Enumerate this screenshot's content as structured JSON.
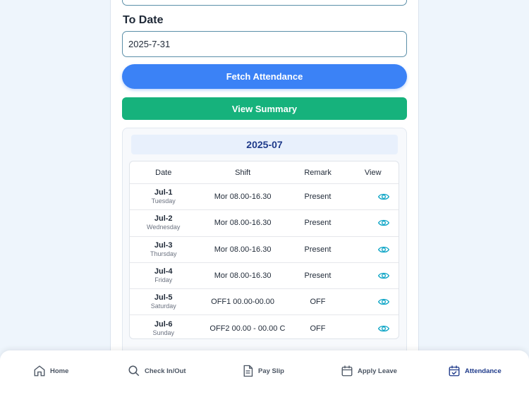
{
  "form": {
    "to_date_label": "To Date",
    "to_date_value": "2025-7-31"
  },
  "buttons": {
    "fetch": "Fetch Attendance",
    "summary": "View Summary"
  },
  "month": "2025-07",
  "table": {
    "headers": [
      "Date",
      "Shift",
      "Remark",
      "View"
    ],
    "rows": [
      {
        "date": "Jul-1",
        "day": "Tuesday",
        "shift": "Mor 08.00-16.30",
        "remark": "Present"
      },
      {
        "date": "Jul-2",
        "day": "Wednesday",
        "shift": "Mor 08.00-16.30",
        "remark": "Present"
      },
      {
        "date": "Jul-3",
        "day": "Thursday",
        "shift": "Mor 08.00-16.30",
        "remark": "Present"
      },
      {
        "date": "Jul-4",
        "day": "Friday",
        "shift": "Mor 08.00-16.30",
        "remark": "Present"
      },
      {
        "date": "Jul-5",
        "day": "Saturday",
        "shift": "OFF1  00.00-00.00",
        "remark": "OFF"
      },
      {
        "date": "Jul-6",
        "day": "Sunday",
        "shift": "OFF2 00.00 - 00.00 C",
        "remark": "OFF"
      }
    ]
  },
  "nav": {
    "home": "Home",
    "check": "Check In/Out",
    "payslip": "Pay Slip",
    "leave": "Apply Leave",
    "attendance": "Attendance"
  },
  "colors": {
    "accent_blue": "#3b82f6",
    "accent_green": "#16b27c",
    "eye_icon": "#0ea5c6",
    "active_nav": "#1e3a8a"
  }
}
